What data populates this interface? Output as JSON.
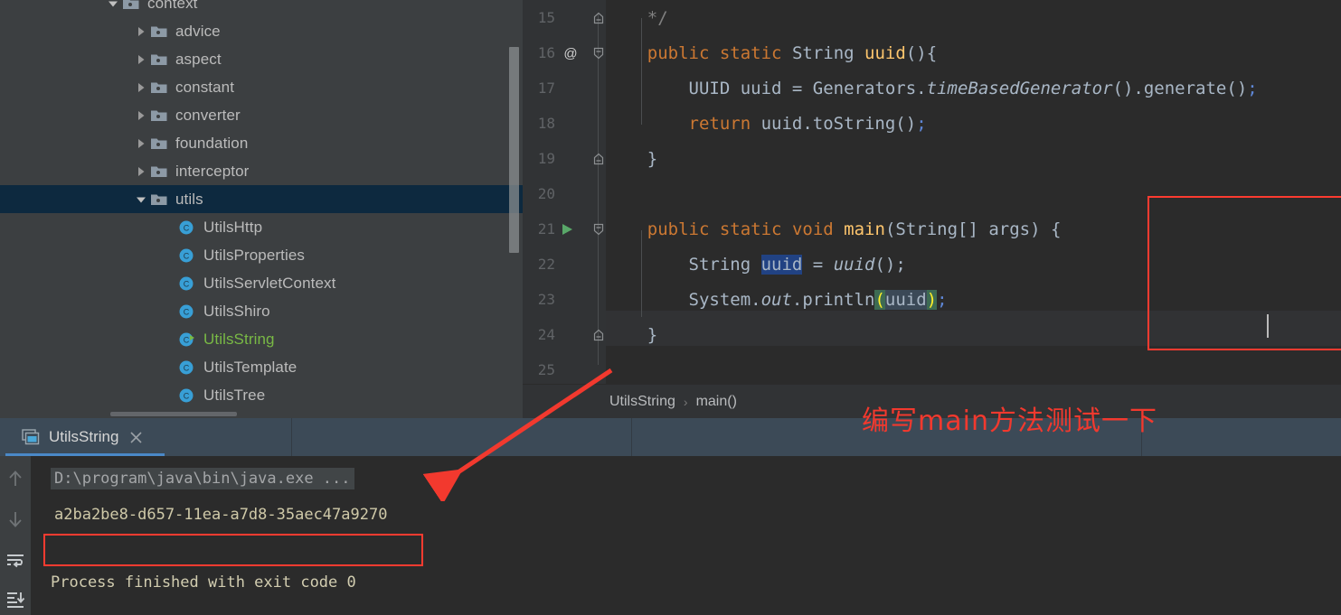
{
  "project_tree": {
    "name": "project-tool-window",
    "rows": [
      {
        "label": "context",
        "depth": 3,
        "kind": "folder",
        "expanded": true,
        "selected": false,
        "partial": true
      },
      {
        "label": "advice",
        "depth": 4,
        "kind": "folder",
        "expanded": false,
        "selected": false
      },
      {
        "label": "aspect",
        "depth": 4,
        "kind": "folder",
        "expanded": false,
        "selected": false
      },
      {
        "label": "constant",
        "depth": 4,
        "kind": "folder",
        "expanded": false,
        "selected": false
      },
      {
        "label": "converter",
        "depth": 4,
        "kind": "folder",
        "expanded": false,
        "selected": false
      },
      {
        "label": "foundation",
        "depth": 4,
        "kind": "folder",
        "expanded": false,
        "selected": false
      },
      {
        "label": "interceptor",
        "depth": 4,
        "kind": "folder",
        "expanded": false,
        "selected": false
      },
      {
        "label": "utils",
        "depth": 4,
        "kind": "folder",
        "expanded": true,
        "selected": true
      },
      {
        "label": "UtilsHttp",
        "depth": 5,
        "kind": "class",
        "selected": false
      },
      {
        "label": "UtilsProperties",
        "depth": 5,
        "kind": "class",
        "selected": false
      },
      {
        "label": "UtilsServletContext",
        "depth": 5,
        "kind": "class",
        "selected": false
      },
      {
        "label": "UtilsShiro",
        "depth": 5,
        "kind": "class",
        "selected": false
      },
      {
        "label": "UtilsString",
        "depth": 5,
        "kind": "class",
        "selected": false,
        "running": true,
        "color": "green"
      },
      {
        "label": "UtilsTemplate",
        "depth": 5,
        "kind": "class",
        "selected": false
      },
      {
        "label": "UtilsTree",
        "depth": 5,
        "kind": "class",
        "selected": false
      }
    ]
  },
  "editor": {
    "name": "code-editor",
    "lines": [
      {
        "number": "15",
        "fold": "end",
        "text": "    */"
      },
      {
        "number": "16",
        "gutter": "at",
        "fold": "start",
        "text": "    public static String uuid(){"
      },
      {
        "number": "17",
        "text": "        UUID uuid = Generators.timeBasedGenerator().generate();"
      },
      {
        "number": "18",
        "text": "        return uuid.toString();"
      },
      {
        "number": "19",
        "fold": "end",
        "text": "    }"
      },
      {
        "number": "20",
        "text": ""
      },
      {
        "number": "21",
        "gutter": "run",
        "fold": "start",
        "text": "    public static void main(String[] args) {"
      },
      {
        "number": "22",
        "text": "        String uuid = uuid();"
      },
      {
        "number": "23",
        "text": "        System.out.println(uuid);"
      },
      {
        "number": "24",
        "fold": "end",
        "text": "    }"
      },
      {
        "number": "25",
        "text": ""
      }
    ],
    "tokens": {
      "l15_comment": "    */",
      "l16_public": "public",
      "l16_sp1": " ",
      "l16_static": "static",
      "l16_sp2": " ",
      "l16_string": "String",
      "l16_sp3": " ",
      "l16_name": "uuid",
      "l16_tail": "(){",
      "l17_uuidtype": "UUID uuid ",
      "l17_eq": "= ",
      "l17_gen": "Generators.",
      "l17_method": "timeBasedGenerator",
      "l17_mid": "().generate()",
      "l17_semi": ";",
      "l18_return": "return",
      "l18_rest": " uuid.toString()",
      "l18_semi": ";",
      "l19_brace": "}",
      "l21_public": "public",
      "l21_sp1": " ",
      "l21_static": "static",
      "l21_sp2": " ",
      "l21_void": "void",
      "l21_sp3": " ",
      "l21_main": "main",
      "l21_args": "(String[] args) {",
      "l22_string": "String ",
      "l22_var": "uuid",
      "l22_eq": " = ",
      "l22_call": "uuid",
      "l22_tail": "();",
      "l23_system": "System.",
      "l23_out": "out",
      "l23_println": ".println",
      "l23_open": "(",
      "l23_arg": "uuid",
      "l23_close": ")",
      "l23_semi": ";",
      "l24_brace": "}"
    },
    "gutter_at_symbol": "@"
  },
  "breadcrumb": {
    "name": "editor-breadcrumb",
    "items": [
      "UtilsString",
      "main()"
    ],
    "separator": "›"
  },
  "annotation": {
    "text": "编写main方法测试一下",
    "color": "#f2392e"
  },
  "run_panel": {
    "tab": {
      "label": "UtilsString",
      "close_glyph": "×"
    },
    "toolbar": [
      {
        "name": "up-arrow-icon"
      },
      {
        "name": "down-arrow-icon"
      },
      {
        "name": "soft-wrap-icon"
      },
      {
        "name": "scroll-to-end-icon"
      }
    ],
    "console": {
      "command": "D:\\program\\java\\bin\\java.exe ...",
      "output": "a2ba2be8-d657-11ea-a7d8-35aec47a9270",
      "exit_message": "Process finished with exit code 0"
    }
  },
  "colors": {
    "accent_blue": "#4a88c7",
    "annotation_red": "#ff3b30",
    "keyword_orange": "#cc7832",
    "keyword_blue": "#5f87d7",
    "method_yellow": "#ffc66d",
    "selection_blue": "#214283",
    "editor_bg": "#2b2b2b",
    "panel_bg": "#3c3f41",
    "tree_selected": "#0d293f",
    "running_green": "#79b945"
  }
}
